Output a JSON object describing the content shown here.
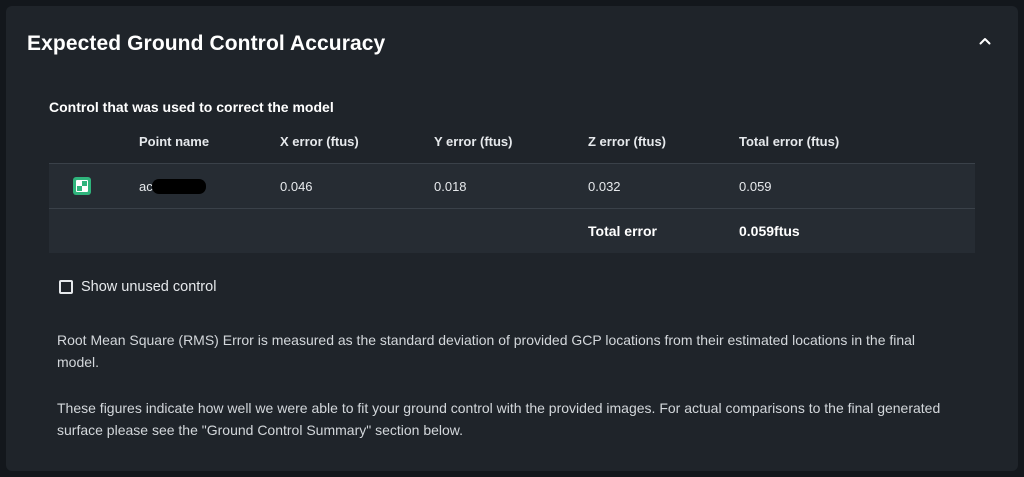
{
  "panel": {
    "title": "Expected Ground Control Accuracy",
    "collapse_icon": "chevron-up-icon"
  },
  "control_section": {
    "heading": "Control that was used to correct the model",
    "columns": [
      "Point name",
      "X error (ftus)",
      "Y error (ftus)",
      "Z error (ftus)",
      "Total error (ftus)"
    ],
    "rows": [
      {
        "icon": "gcp-marker-icon",
        "point_name": "ac",
        "x_error": "0.046",
        "y_error": "0.018",
        "z_error": "0.032",
        "total_error": "0.059"
      }
    ],
    "total": {
      "label": "Total error",
      "value": "0.059ftus"
    }
  },
  "show_unused": {
    "label": "Show unused control",
    "checked": false
  },
  "description": {
    "p1": "Root Mean Square (RMS) Error is measured as the standard deviation of provided GCP locations from their estimated locations in the final model.",
    "p2": "These figures indicate how well we were able to fit your ground control with the provided images. For actual comparisons to the final generated surface please see the \"Ground Control Summary\" section below."
  },
  "colors": {
    "background": "#13171c",
    "panel": "#1f242a",
    "row": "#262c33",
    "accent": "#2fb47c"
  }
}
